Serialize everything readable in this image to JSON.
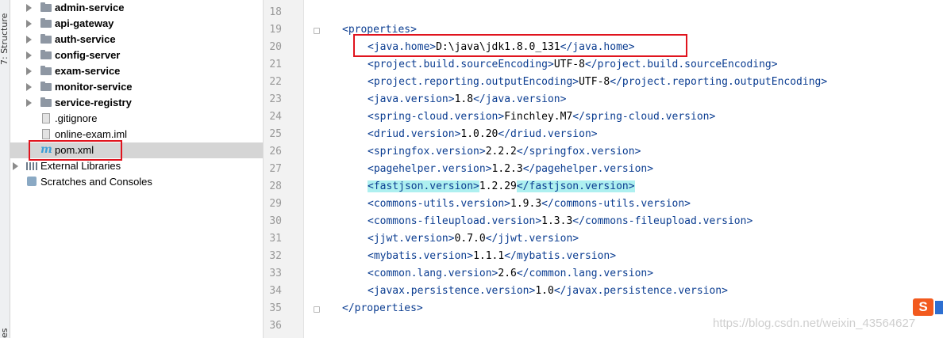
{
  "side_tabs": {
    "structure": "7: Structure",
    "bottom": "es"
  },
  "project_tree": [
    {
      "label": "admin-service",
      "kind": "module",
      "bold": true
    },
    {
      "label": "api-gateway",
      "kind": "module",
      "bold": true
    },
    {
      "label": "auth-service",
      "kind": "module",
      "bold": true
    },
    {
      "label": "config-server",
      "kind": "module",
      "bold": true
    },
    {
      "label": "exam-service",
      "kind": "module",
      "bold": true
    },
    {
      "label": "monitor-service",
      "kind": "module",
      "bold": true
    },
    {
      "label": "service-registry",
      "kind": "module",
      "bold": true
    },
    {
      "label": ".gitignore",
      "kind": "file"
    },
    {
      "label": "online-exam.iml",
      "kind": "file"
    },
    {
      "label": "pom.xml",
      "kind": "maven",
      "selected": true
    },
    {
      "label": "External Libraries",
      "kind": "library"
    },
    {
      "label": "Scratches and Consoles",
      "kind": "scratch"
    }
  ],
  "editor": {
    "lines": [
      {
        "n": "18",
        "text": ""
      },
      {
        "n": "19",
        "text": "<properties>"
      },
      {
        "n": "20",
        "text": "<java.home>D:\\java\\jdk1.8.0_131</java.home>"
      },
      {
        "n": "21",
        "text": "<project.build.sourceEncoding>UTF-8</project.build.sourceEncoding>"
      },
      {
        "n": "22",
        "text": "<project.reporting.outputEncoding>UTF-8</project.reporting.outputEncoding>"
      },
      {
        "n": "23",
        "text": "<java.version>1.8</java.version>"
      },
      {
        "n": "24",
        "text": "<spring-cloud.version>Finchley.M7</spring-cloud.version>"
      },
      {
        "n": "25",
        "text": "<driud.version>1.0.20</driud.version>"
      },
      {
        "n": "26",
        "text": "<springfox.version>2.2.2</springfox.version>"
      },
      {
        "n": "27",
        "text": "<pagehelper.version>1.2.3</pagehelper.version>"
      },
      {
        "n": "28",
        "text": "<fastjson.version>1.2.29</fastjson.version>"
      },
      {
        "n": "29",
        "text": "<commons-utils.version>1.9.3</commons-utils.version>"
      },
      {
        "n": "30",
        "text": "<commons-fileupload.version>1.3.3</commons-fileupload.version>"
      },
      {
        "n": "31",
        "text": "<jjwt.version>0.7.0</jjwt.version>"
      },
      {
        "n": "32",
        "text": "<mybatis.version>1.1.1</mybatis.version>"
      },
      {
        "n": "33",
        "text": "<common.lang.version>2.6</common.lang.version>"
      },
      {
        "n": "34",
        "text": "<javax.persistence.version>1.0</javax.persistence.version>"
      },
      {
        "n": "35",
        "text": "</properties>"
      },
      {
        "n": "36",
        "text": ""
      }
    ]
  },
  "watermark": "https://blog.csdn.net/weixin_43564627",
  "ime_badge": "S",
  "icons": {
    "folder": "folder-icon",
    "arrow": "chevron-right-icon",
    "maven": "maven-icon",
    "library": "library-icon",
    "scratch": "scratch-icon",
    "file": "file-icon"
  },
  "colors": {
    "tag": "#0b3d91",
    "highlight": "#aef0f0",
    "annotation": "#e0141e",
    "caret_line": "#fbfbe6"
  }
}
